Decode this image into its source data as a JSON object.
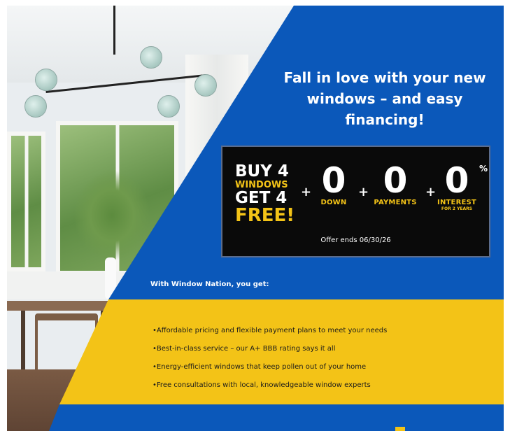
{
  "headline": "Fall in love with your new windows – and easy financing!",
  "offer": {
    "bogo_line1": "BUY 4",
    "bogo_line2": "WINDOWS",
    "bogo_line3": "GET 4",
    "bogo_line4": "FREE!",
    "plus": "+",
    "zero": "0",
    "down_label": "DOWN",
    "payments_label": "PAYMENTS",
    "interest_label": "INTEREST",
    "interest_sub": "FOR 2 YEARS",
    "percent": "%",
    "ends": "Offer ends 06/30/26"
  },
  "benefits_title": "With Window Nation, you get:",
  "benefits": [
    "•Affordable pricing and flexible payment plans to meet your needs",
    "•Best-in-class service – our A+ BBB rating says it all",
    "•Energy-efficient windows that keep pollen out of your home",
    "•Free consultations with local, knowledgeable window experts"
  ],
  "colors": {
    "blue": "#0b58ba",
    "yellow": "#f3c317",
    "offer_bg": "#0a0a0a"
  }
}
